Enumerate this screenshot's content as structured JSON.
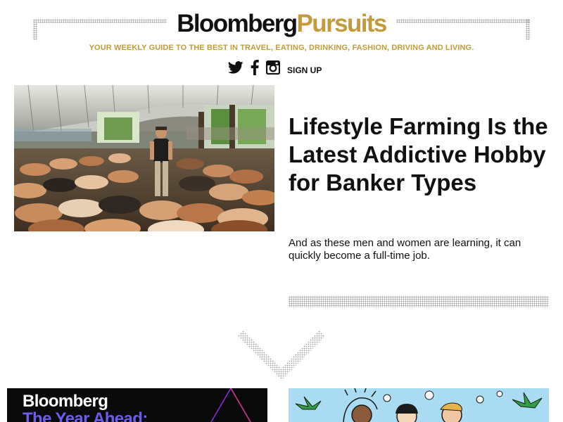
{
  "brand": {
    "logo_part1": "Bloomberg",
    "logo_part2": "Pursuits",
    "tagline": "YOUR WEEKLY GUIDE TO THE BEST IN TRAVEL, EATING, DRINKING, FASHION, DRIVING AND LIVING.",
    "accent_color": "#c49a3d",
    "text_color": "#111111"
  },
  "social": {
    "icons": [
      "twitter-icon",
      "facebook-icon",
      "instagram-icon"
    ],
    "signup_label": "SIGN UP"
  },
  "hero": {
    "image_subject": "farm-barn-with-pigs-photo",
    "title": "Lifestyle Farming Is the Latest Addictive Hobby for Banker Types",
    "dek": "And as these men and women are learning, it can quickly become a full-time job."
  },
  "cards": [
    {
      "line1": "Bloomberg",
      "line2": "The Year Ahead:",
      "background": "#0a0a0a",
      "line2_color": "#6d5cf0"
    },
    {
      "image_subject": "illustrated-people-palm-trees",
      "background": "#a9dcf2"
    }
  ]
}
